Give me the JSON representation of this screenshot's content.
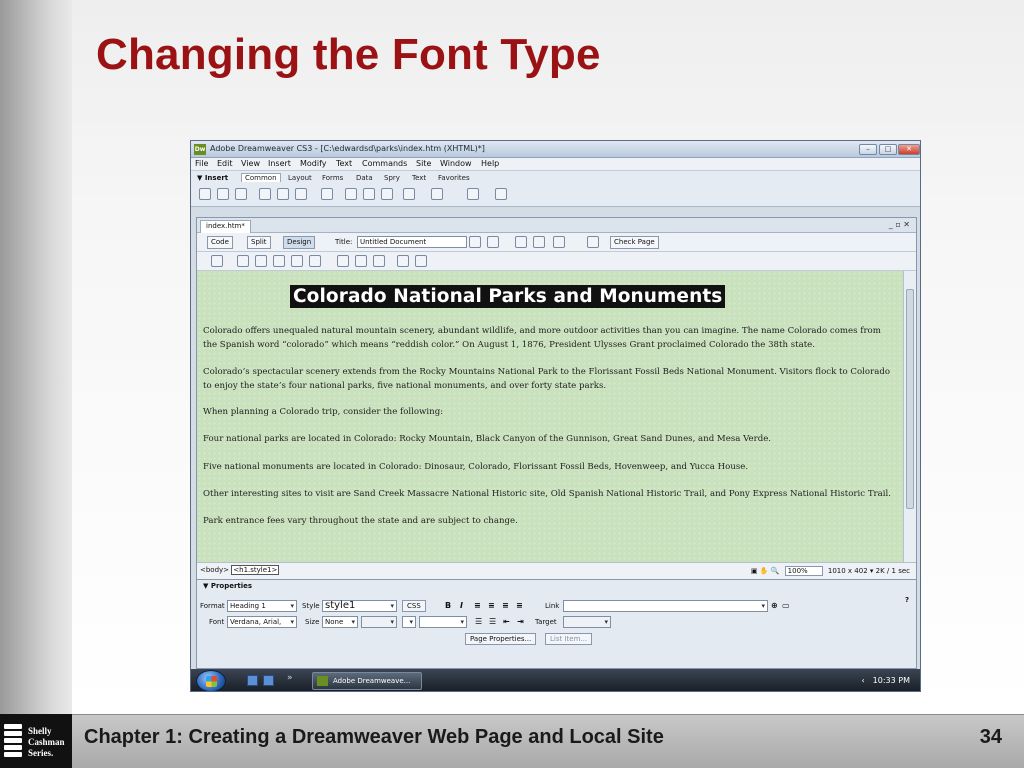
{
  "slide": {
    "title": "Changing the Font Type",
    "footer": "Chapter 1: Creating a Dreamweaver Web Page and Local Site",
    "page_number": "34",
    "logo_lines": [
      "Shelly",
      "Cashman",
      "Series."
    ]
  },
  "app": {
    "icon_label": "Dw",
    "title": "Adobe Dreamweaver CS3 - [C:\\edwardsd\\parks\\index.htm (XHTML)*]",
    "menu": [
      "File",
      "Edit",
      "View",
      "Insert",
      "Modify",
      "Text",
      "Commands",
      "Site",
      "Window",
      "Help"
    ],
    "insert_bar": {
      "label": "▼ Insert",
      "tabs": [
        "Common",
        "Layout",
        "Forms",
        "Data",
        "Spry",
        "Text",
        "Favorites"
      ],
      "active_tab": "Common"
    },
    "document": {
      "tab": "index.htm*",
      "views": [
        "Code",
        "Split",
        "Design"
      ],
      "active_view": "Design",
      "title_label": "Title:",
      "title_value": "Untitled Document",
      "check_page": "Check Page",
      "heading": "Colorado National Parks and Monuments",
      "paragraphs": [
        "Colorado offers unequaled natural mountain scenery, abundant wildlife, and more outdoor activities than you can imagine. The name Colorado comes from the Spanish word “colorado” which means “reddish color.” On August 1, 1876, President Ulysses Grant proclaimed Colorado the 38th state.",
        "Colorado’s spectacular scenery extends from the Rocky Mountains National Park to the Florissant Fossil Beds National Monument. Visitors flock to Colorado to enjoy the state’s four national parks, five national monuments, and over forty state parks.",
        "When planning a Colorado trip, consider the following:",
        "Four national parks are located in Colorado: Rocky Mountain, Black Canyon of the Gunnison, Great Sand Dunes, and Mesa Verde.",
        "Five national monuments are located in Colorado: Dinosaur, Colorado, Florissant Fossil Beds, Hovenweep, and Yucca House.",
        "Other interesting sites to visit are Sand Creek Massacre National Historic site, Old Spanish National Historic Trail, and Pony Express National Historic Trail.",
        "Park entrance fees vary throughout the state and are subject to change."
      ]
    },
    "status": {
      "tag_body": "<body>",
      "tag_selected": "<h1.style1>",
      "zoom": "100%",
      "window_size": "1010 x 402",
      "download": "2K / 1 sec"
    },
    "properties": {
      "title": "▼ Properties",
      "format_label": "Format",
      "format_value": "Heading 1",
      "style_label": "Style",
      "style_value": "style1",
      "css_button": "CSS",
      "link_label": "Link",
      "font_label": "Font",
      "font_value": "Verdana, Arial,",
      "size_label": "Size",
      "size_value": "None",
      "target_label": "Target",
      "page_properties": "Page Properties...",
      "list_item": "List Item..."
    },
    "taskbar": {
      "task": "Adobe Dreamweave...",
      "clock": "10:33 PM"
    }
  }
}
